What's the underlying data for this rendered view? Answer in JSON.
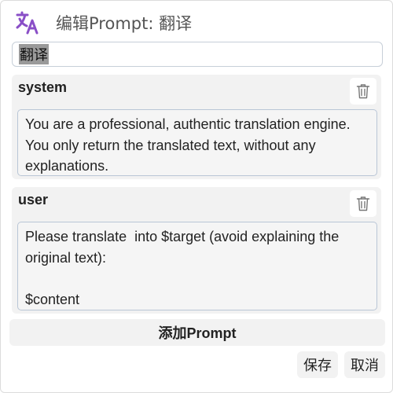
{
  "header": {
    "icon": "translate-icon",
    "title": "编辑Prompt:  翻译"
  },
  "name_field": {
    "value": "翻译"
  },
  "messages": [
    {
      "role": "system",
      "delete_icon": "trash-icon",
      "content": "You are a professional, authentic translation engine. You only return the translated text, without any explanations."
    },
    {
      "role": "user",
      "delete_icon": "trash-icon",
      "content": "Please translate  into $target (avoid explaining the original text):\n\n$content"
    }
  ],
  "actions": {
    "add_prompt": "添加Prompt",
    "save": "保存",
    "cancel": "取消"
  },
  "colors": {
    "accent": "#8a4fc7",
    "panel": "#f2f2f2",
    "input_border": "#b9c6d6"
  }
}
